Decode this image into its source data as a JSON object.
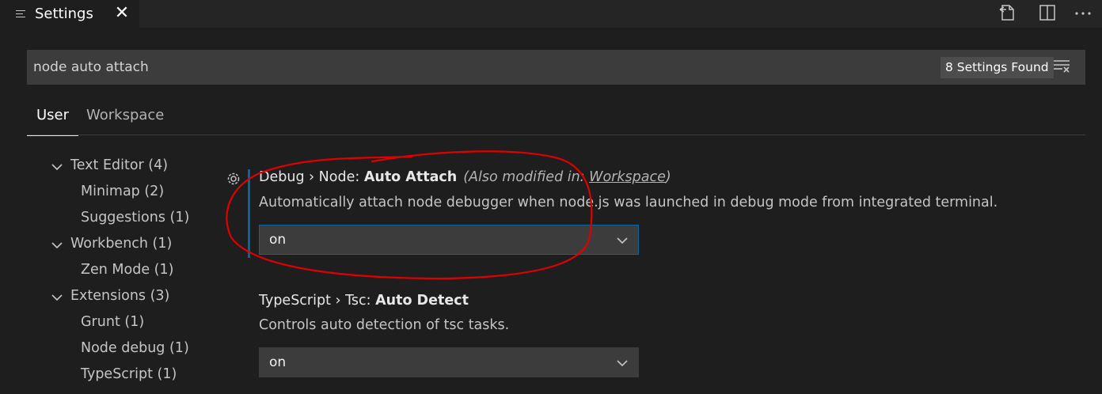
{
  "tab": {
    "title": "Settings",
    "close_glyph": "✕"
  },
  "toolbar": {
    "icons": [
      "open-settings-json-icon",
      "split-editor-icon",
      "more-actions-icon"
    ]
  },
  "search": {
    "value": "node auto attach",
    "results_badge": "8 Settings Found"
  },
  "scope_tabs": {
    "user": "User",
    "workspace": "Workspace"
  },
  "toc": {
    "items": [
      {
        "label": "Text Editor (4)",
        "expanded": true
      },
      {
        "label": "Minimap (2)"
      },
      {
        "label": "Suggestions (1)"
      },
      {
        "label": "Workbench (1)",
        "expanded": true
      },
      {
        "label": "Zen Mode (1)"
      },
      {
        "label": "Extensions (3)",
        "expanded": true
      },
      {
        "label": "Grunt (1)"
      },
      {
        "label": "Node debug (1)"
      },
      {
        "label": "TypeScript (1)"
      }
    ]
  },
  "settings": [
    {
      "category": "Debug › Node: ",
      "name": "Auto Attach",
      "modified_prefix": "(Also modified in: ",
      "modified_link": "Workspace",
      "modified_suffix": ")",
      "description": "Automatically attach node debugger when node.js was launched in debug mode from integrated terminal.",
      "value": "on"
    },
    {
      "category": "TypeScript › Tsc: ",
      "name": "Auto Detect",
      "description": "Controls auto detection of tsc tasks.",
      "value": "on"
    }
  ],
  "colors": {
    "background": "#1e1e1e",
    "focus_border": "#0e639c",
    "annotation": "#e00000"
  }
}
